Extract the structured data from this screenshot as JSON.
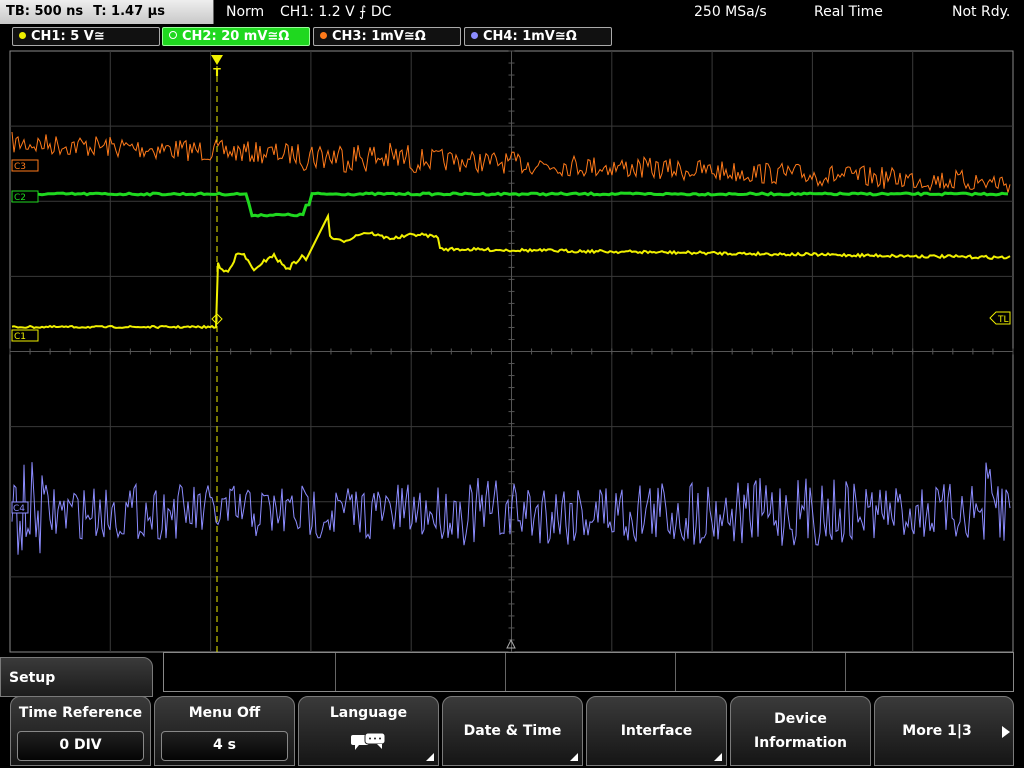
{
  "status_bar": {
    "timebase": "TB: 500 ns",
    "trigger_time": "T: 1.47 µs",
    "acq_mode": "Norm",
    "trigger_info": "CH1: 1.2 V ⨍ DC",
    "sample_rate": "250 MSa/s",
    "realtime": "Real Time",
    "status": "Not Rdy."
  },
  "channels": [
    {
      "label": "CH1: 5 V≅",
      "color": "#f0f000"
    },
    {
      "label": "CH2: 20 mV≅Ω",
      "color": "#1fd81f"
    },
    {
      "label": "CH3: 1mV≅Ω",
      "color": "#ff7a1a"
    },
    {
      "label": "CH4: 1mV≅Ω",
      "color": "#8c8cff"
    }
  ],
  "markers": {
    "c3": "C3",
    "c2": "C2",
    "c1": "C1",
    "c4": "C4",
    "tl": "TL",
    "trigger": "T"
  },
  "menu": {
    "title": "Setup",
    "buttons": [
      {
        "label": "Time Reference",
        "value": "0 DIV"
      },
      {
        "label": "Menu Off",
        "value": "4 s"
      },
      {
        "label": "Language",
        "icon": "speech-bubble-icon"
      },
      {
        "label": "Date & Time"
      },
      {
        "label": "Interface"
      },
      {
        "label": "Device\nInformation",
        "line1": "Device",
        "line2": "Information"
      },
      {
        "label": "More 1|3"
      }
    ]
  }
}
